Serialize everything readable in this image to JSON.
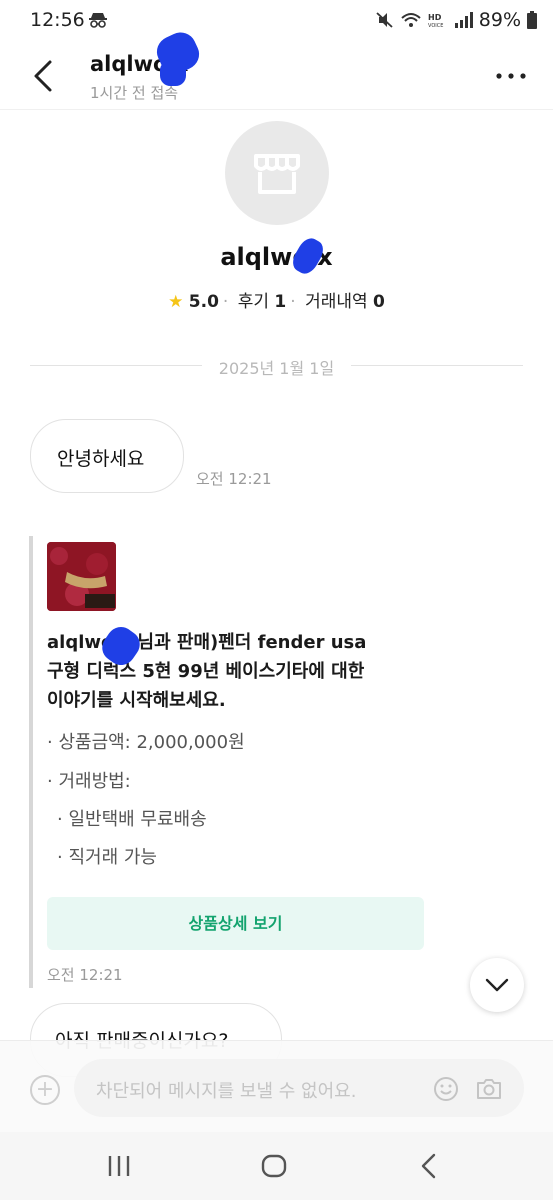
{
  "status_bar": {
    "time": "12:56",
    "battery": "89%"
  },
  "header": {
    "username": "alqlwo x",
    "last_seen": "1시간 전 접속"
  },
  "profile": {
    "username": "alqlwo x",
    "rating": "5.0",
    "reviews_label": "후기",
    "reviews_count": "1",
    "trades_label": "거래내역",
    "trades_count": "0"
  },
  "chat": {
    "date": "2025년 1월 1일",
    "message1": {
      "text": "안녕하세요",
      "time": "오전 12:21"
    },
    "product_card": {
      "title_lines": [
        "alqlwo x 님과 판매)펜더 fender usa",
        "구형 디럭스 5현 99년 베이스기타에 대한",
        "이야기를 시작해보세요."
      ],
      "price_line": "· 상품금액: 2,000,000원",
      "method_label": "· 거래방법:",
      "method_1": "· 일반택배 무료배송",
      "method_2": "· 직거래 가능",
      "detail_button": "상품상세 보기",
      "time": "오전 12:21"
    },
    "message2": {
      "text": "아직 판매중이신가요?"
    }
  },
  "input": {
    "placeholder": "차단되어 메시지를 보낼 수 없어요."
  },
  "icons": {
    "back": "chevron-left-icon",
    "more": "more-horizontal-icon",
    "avatar": "storefront-icon",
    "star": "star-icon",
    "scroll": "chevron-down-icon",
    "plus": "plus-circle-icon",
    "emoji": "smiley-icon",
    "camera": "camera-icon"
  },
  "colors": {
    "accent_green": "#13a36e",
    "detail_bg": "#e8f8f3",
    "star": "#f5c518",
    "scribble": "#1f3fe6"
  }
}
